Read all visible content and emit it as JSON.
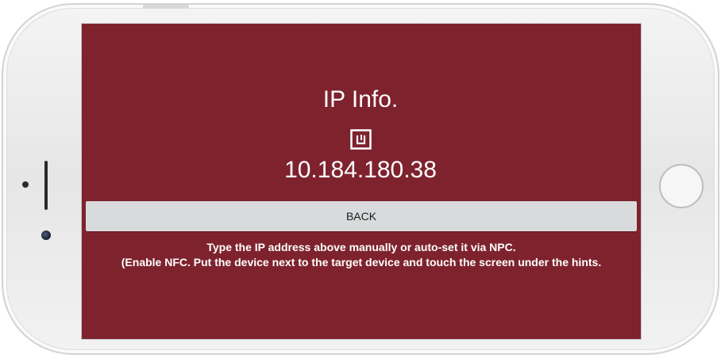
{
  "screen": {
    "title": "IP Info.",
    "icon": "nfc-icon",
    "ip_address": "10.184.180.38",
    "back_label": "BACK",
    "hint_line1": "Type the IP address above manually or auto-set it via NPC.",
    "hint_line2": "(Enable NFC. Put the device next to the target device and touch the screen under the hints."
  },
  "colors": {
    "screen_background": "#7e232e",
    "button_background": "#d9dadb",
    "text": "#ffffff"
  }
}
